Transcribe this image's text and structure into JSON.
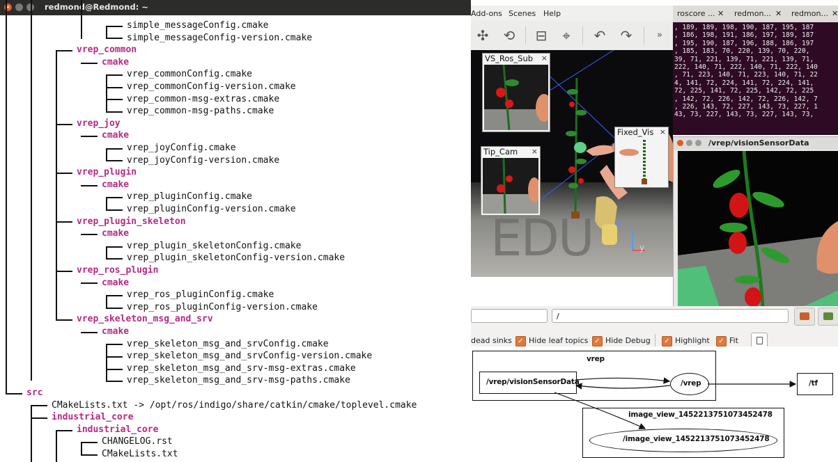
{
  "terminal": {
    "title": "redmond@Redmond: ~",
    "close_glyph": "✕",
    "rows": [
      {
        "text": "simple_messageConfig.cmake",
        "kind": "file"
      },
      {
        "text": "simple_messageConfig-version.cmake",
        "kind": "file"
      },
      {
        "text": "vrep_common",
        "kind": "dir"
      },
      {
        "text": "cmake",
        "kind": "dir"
      },
      {
        "text": "vrep_commonConfig.cmake",
        "kind": "file"
      },
      {
        "text": "vrep_commonConfig-version.cmake",
        "kind": "file"
      },
      {
        "text": "vrep_common-msg-extras.cmake",
        "kind": "file"
      },
      {
        "text": "vrep_common-msg-paths.cmake",
        "kind": "file"
      },
      {
        "text": "vrep_joy",
        "kind": "dir"
      },
      {
        "text": "cmake",
        "kind": "dir"
      },
      {
        "text": "vrep_joyConfig.cmake",
        "kind": "file"
      },
      {
        "text": "vrep_joyConfig-version.cmake",
        "kind": "file"
      },
      {
        "text": "vrep_plugin",
        "kind": "dir"
      },
      {
        "text": "cmake",
        "kind": "dir"
      },
      {
        "text": "vrep_pluginConfig.cmake",
        "kind": "file"
      },
      {
        "text": "vrep_pluginConfig-version.cmake",
        "kind": "file"
      },
      {
        "text": "vrep_plugin_skeleton",
        "kind": "dir"
      },
      {
        "text": "cmake",
        "kind": "dir"
      },
      {
        "text": "vrep_plugin_skeletonConfig.cmake",
        "kind": "file"
      },
      {
        "text": "vrep_plugin_skeletonConfig-version.cmake",
        "kind": "file"
      },
      {
        "text": "vrep_ros_plugin",
        "kind": "dir"
      },
      {
        "text": "cmake",
        "kind": "dir"
      },
      {
        "text": "vrep_ros_pluginConfig.cmake",
        "kind": "file"
      },
      {
        "text": "vrep_ros_pluginConfig-version.cmake",
        "kind": "file"
      },
      {
        "text": "vrep_skeleton_msg_and_srv",
        "kind": "dir"
      },
      {
        "text": "cmake",
        "kind": "dir"
      },
      {
        "text": "vrep_skeleton_msg_and_srvConfig.cmake",
        "kind": "file"
      },
      {
        "text": "vrep_skeleton_msg_and_srvConfig-version.cmake",
        "kind": "file"
      },
      {
        "text": "vrep_skeleton_msg_and_srv-msg-extras.cmake",
        "kind": "file"
      },
      {
        "text": "vrep_skeleton_msg_and_srv-msg-paths.cmake",
        "kind": "file"
      },
      {
        "text": "src",
        "kind": "dir"
      },
      {
        "text": "CMakeLists.txt -> /opt/ros/indigo/share/catkin/cmake/toplevel.cmake",
        "kind": "link"
      },
      {
        "text": "industrial_core",
        "kind": "dir"
      },
      {
        "text": "industrial_core",
        "kind": "dir"
      },
      {
        "text": "CHANGELOG.rst",
        "kind": "file"
      },
      {
        "text": "CMakeLists.txt",
        "kind": "file"
      }
    ]
  },
  "vrep": {
    "menu": [
      "Add-ons",
      "Scenes",
      "Help"
    ],
    "toolbar_more": "»",
    "watermark": "EDU",
    "subwindows": [
      {
        "caption": "VS_Ros_Sub",
        "close": "×"
      },
      {
        "caption": "Tip_Cam",
        "close": "×"
      },
      {
        "caption": "Fixed_Vis",
        "close": "×"
      }
    ],
    "axis_z": "z",
    "axis_y": "y"
  },
  "roscore": {
    "tabs": [
      "roscore ...",
      "redmon...",
      "redmon..."
    ],
    "tab_close": "✕",
    "lines": [
      ", 189, 189, 198, 190, 187, 195, 187",
      ", 186, 198, 191, 186, 197, 189, 187",
      ", 195, 190, 187, 196, 188, 186, 197",
      ", 185, 183, 70, 220, 139, 70, 220,",
      "39, 71, 221, 139, 71, 221, 139, 71,",
      "222, 140, 71, 222, 140, 71, 222, 140",
      ", 71, 223, 140, 71, 223, 140, 71, 22",
      "4, 141, 72, 224, 141, 72, 224, 141,",
      "72, 225, 141, 72, 225, 142, 72, 225",
      ", 142, 72, 226, 142, 72, 226, 142, 7",
      ", 226, 143, 72, 227, 143, 73, 227, 1",
      "43, 73, 227, 143, 73, 227, 143, 73,"
    ]
  },
  "image_view": {
    "title": "/vrep/visionSensorData"
  },
  "rqt": {
    "topic_field": "/",
    "checkboxes": [
      "dead sinks",
      "Hide leaf topics",
      "Hide Debug",
      "Highlight",
      "Fit"
    ],
    "check_glyph": "✓",
    "graph": {
      "cluster_vrep": "vrep",
      "node_topic": "/vrep/visionSensorData",
      "node_vrep": "/vrep",
      "node_tf": "/tf",
      "cluster_image": "image_view_1452213751073452478",
      "node_image": "/image_view_1452213751073452478"
    }
  }
}
